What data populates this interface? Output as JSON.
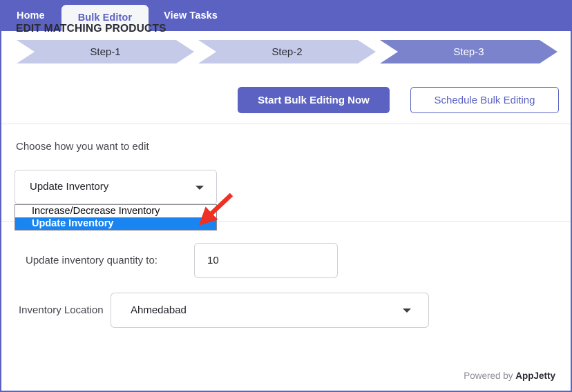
{
  "navbar": {
    "tabs": [
      {
        "label": "Home",
        "active": false
      },
      {
        "label": "Bulk Editor",
        "active": true
      },
      {
        "label": "View Tasks",
        "active": false
      }
    ]
  },
  "steps": [
    {
      "label": "Step-1",
      "active": false
    },
    {
      "label": "Step-2",
      "active": false
    },
    {
      "label": "Step-3",
      "active": true
    }
  ],
  "header": {
    "title": "EDIT MATCHING PRODUCTS",
    "primary_button": "Start Bulk Editing Now",
    "outline_button": "Schedule Bulk Editing"
  },
  "body": {
    "choose_label": "Choose how you want to edit",
    "edit_mode_select": {
      "value": "Update Inventory",
      "open": true,
      "options": [
        {
          "label": "Increase/Decrease Inventory",
          "selected": false
        },
        {
          "label": "Update Inventory",
          "selected": true
        }
      ],
      "arrow_icon": "chevron-down-icon"
    },
    "quantity": {
      "label": "Update inventory quantity to:",
      "value": "10",
      "placeholder": ""
    },
    "location": {
      "label": "Inventory Location",
      "value": "Ahmedabad",
      "arrow_icon": "chevron-down-icon"
    },
    "annotation": {
      "type": "red-arrow",
      "color": "#ee3124",
      "points_to": "Update Inventory"
    }
  },
  "footer": {
    "powered_by": "Powered by ",
    "brand": "AppJetty"
  },
  "colors": {
    "brand_purple": "#5b62c2",
    "step_inactive": "#c5cae9",
    "step_active": "#7b83cd",
    "highlight_blue": "#1a85f0",
    "annotation_red": "#ee3124"
  }
}
